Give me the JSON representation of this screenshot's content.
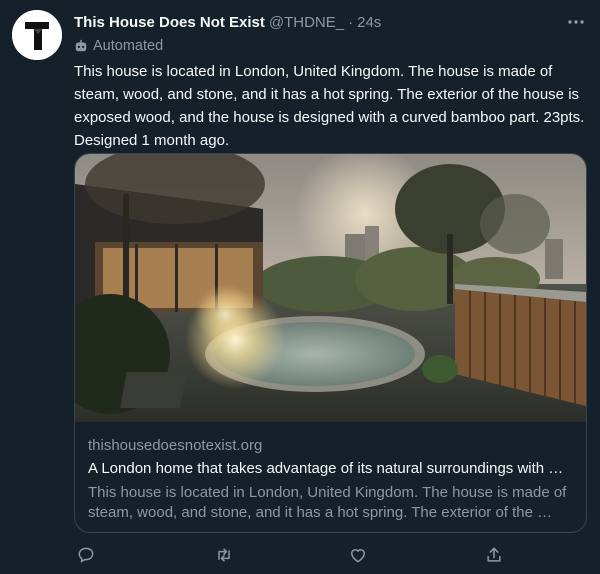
{
  "tweet": {
    "display_name": "This House Does Not Exist",
    "handle": "@THDNE_",
    "separator": "·",
    "time": "24s",
    "automated_label": "Automated",
    "text": "This house is located in London, United Kingdom. The house is made of steam, wood, and stone, and it has a hot spring. The exterior of the house is exposed wood, and the house is designed with a curved bamboo part. 23pts. Designed 1 month ago."
  },
  "card": {
    "domain": "thishousedoesnotexist.org",
    "title": "A London home that takes advantage of its natural surroundings with …",
    "description": "This house is located in London, United Kingdom. The house is made of steam, wood, and stone, and it has a hot spring. The exterior of the …"
  },
  "icons": {
    "avatar": "thdne-logo",
    "more": "more-icon",
    "automated": "robot-icon",
    "reply": "reply-icon",
    "retweet": "retweet-icon",
    "like": "heart-icon",
    "share": "share-icon"
  },
  "colors": {
    "background": "#15202b",
    "text_primary": "#f7f9f9",
    "text_secondary": "#8b98a5",
    "border": "#38444d"
  }
}
